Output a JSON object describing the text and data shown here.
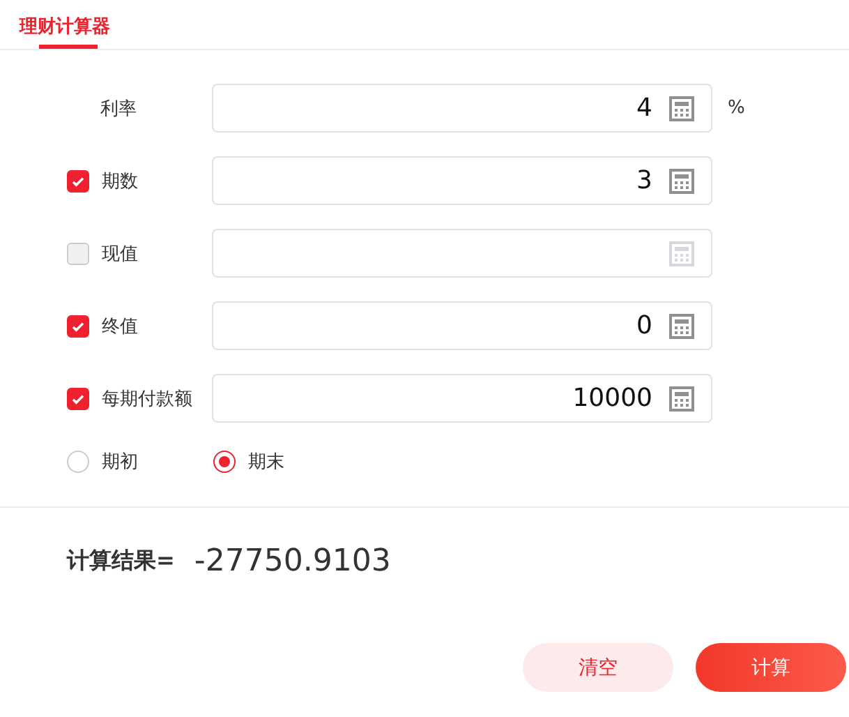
{
  "tabs": [
    {
      "label": "理财计算器",
      "selected": true
    }
  ],
  "rows": [
    {
      "kind": "plain",
      "label": "利率",
      "value": "4",
      "unit": "%"
    },
    {
      "kind": "checkbox",
      "label": "期数",
      "checked": true,
      "value": "3"
    },
    {
      "kind": "checkbox",
      "label": "现值",
      "checked": false
    },
    {
      "kind": "checkbox",
      "label": "终值",
      "checked": true,
      "value": "0"
    },
    {
      "kind": "checkbox",
      "label": "每期付款额",
      "checked": true,
      "value": "10000"
    }
  ],
  "timing": [
    {
      "label": "期初",
      "selected": false
    },
    {
      "label": "期末",
      "selected": true
    }
  ],
  "result": {
    "label": "计算结果=",
    "value": "-27750.9103"
  },
  "buttons": [
    {
      "kind": "secondary",
      "label": "清空"
    },
    {
      "kind": "primary",
      "label": "计算"
    }
  ]
}
